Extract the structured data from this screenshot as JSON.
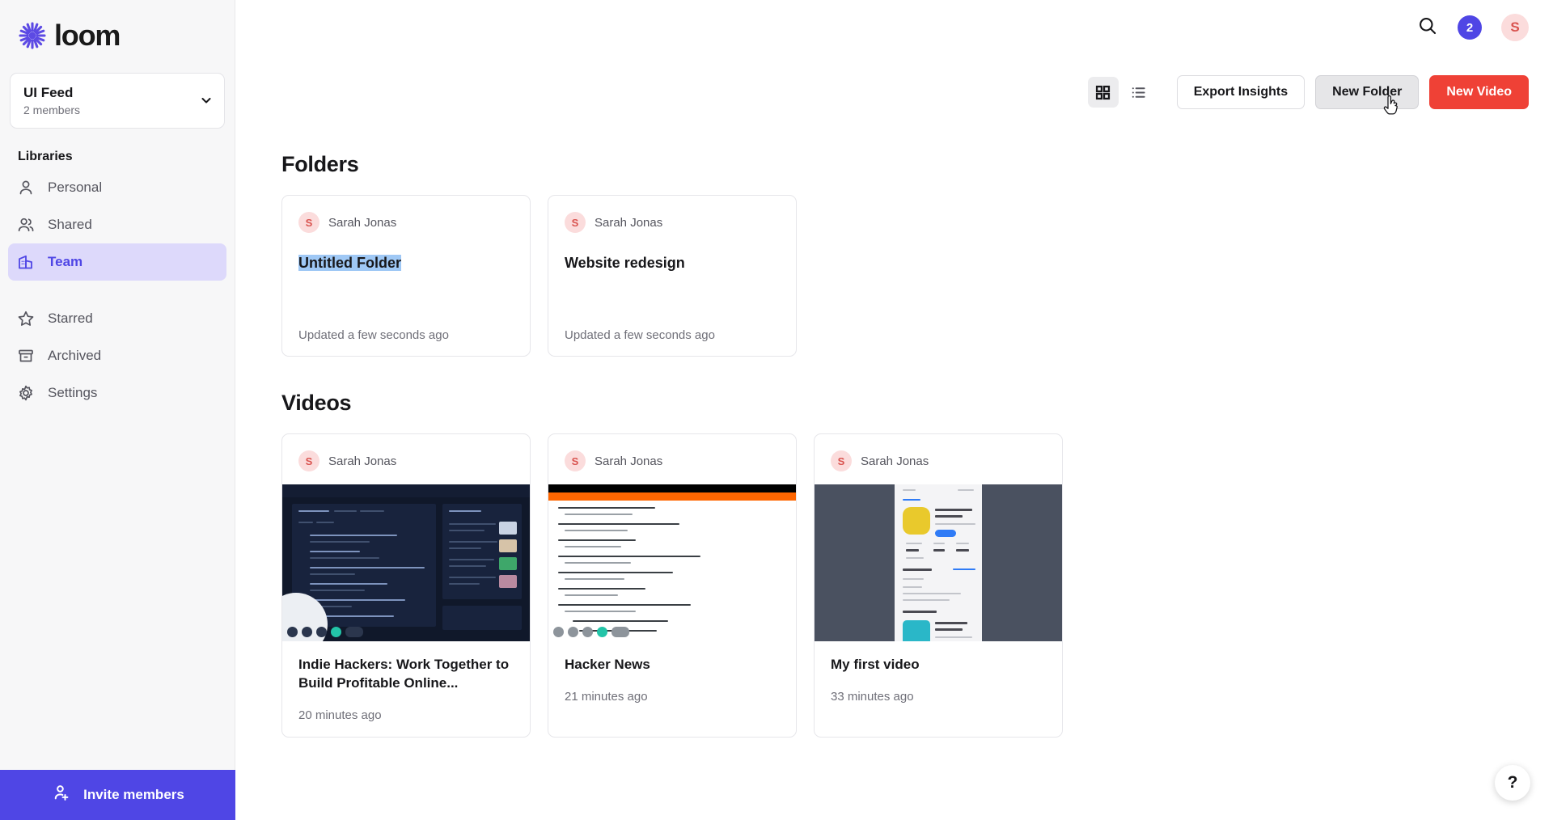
{
  "brand": {
    "name": "loom",
    "logo_icon": "loom-starburst-icon",
    "accent": "#4f46e5"
  },
  "sidebar": {
    "workspace": {
      "name": "UI Feed",
      "members": "2 members",
      "chevron_icon": "chevron-down-icon"
    },
    "section_label": "Libraries",
    "items": [
      {
        "label": "Personal",
        "icon": "person-icon",
        "active": false
      },
      {
        "label": "Shared",
        "icon": "people-icon",
        "active": false
      },
      {
        "label": "Team",
        "icon": "building-icon",
        "active": true
      },
      {
        "label": "Starred",
        "icon": "star-icon",
        "active": false
      },
      {
        "label": "Archived",
        "icon": "archive-box-icon",
        "active": false
      },
      {
        "label": "Settings",
        "icon": "gear-icon",
        "active": false
      }
    ],
    "invite": {
      "label": "Invite members",
      "icon": "add-person-icon"
    }
  },
  "topbar": {
    "search_icon": "search-icon",
    "notification_count": "2",
    "avatar_initial": "S"
  },
  "toolbar": {
    "grid_view_icon": "grid-view-icon",
    "list_view_icon": "list-view-icon",
    "grid_active": true,
    "export_label": "Export Insights",
    "new_folder_label": "New Folder",
    "new_video_label": "New Video",
    "new_video_color": "#ef4136",
    "cursor_icon": "pointing-hand-cursor"
  },
  "folders_section": {
    "heading": "Folders",
    "cards": [
      {
        "owner": "Sarah Jonas",
        "owner_initial": "S",
        "title": "Untitled Folder",
        "selected": true,
        "updated": "Updated a few seconds ago"
      },
      {
        "owner": "Sarah Jonas",
        "owner_initial": "S",
        "title": "Website redesign",
        "selected": false,
        "updated": "Updated a few seconds ago"
      }
    ]
  },
  "videos_section": {
    "heading": "Videos",
    "cards": [
      {
        "owner": "Sarah Jonas",
        "owner_initial": "S",
        "title": "Indie Hackers: Work Together to Build Profitable Online...",
        "time": "20 minutes ago",
        "thumb": "indie-hackers-dark-page"
      },
      {
        "owner": "Sarah Jonas",
        "owner_initial": "S",
        "title": "Hacker News",
        "time": "21 minutes ago",
        "thumb": "hacker-news-page"
      },
      {
        "owner": "Sarah Jonas",
        "owner_initial": "S",
        "title": "My first video",
        "time": "33 minutes ago",
        "thumb": "app-store-memrise-mobile"
      }
    ]
  },
  "help": {
    "label": "?",
    "icon": "question-mark-icon"
  }
}
